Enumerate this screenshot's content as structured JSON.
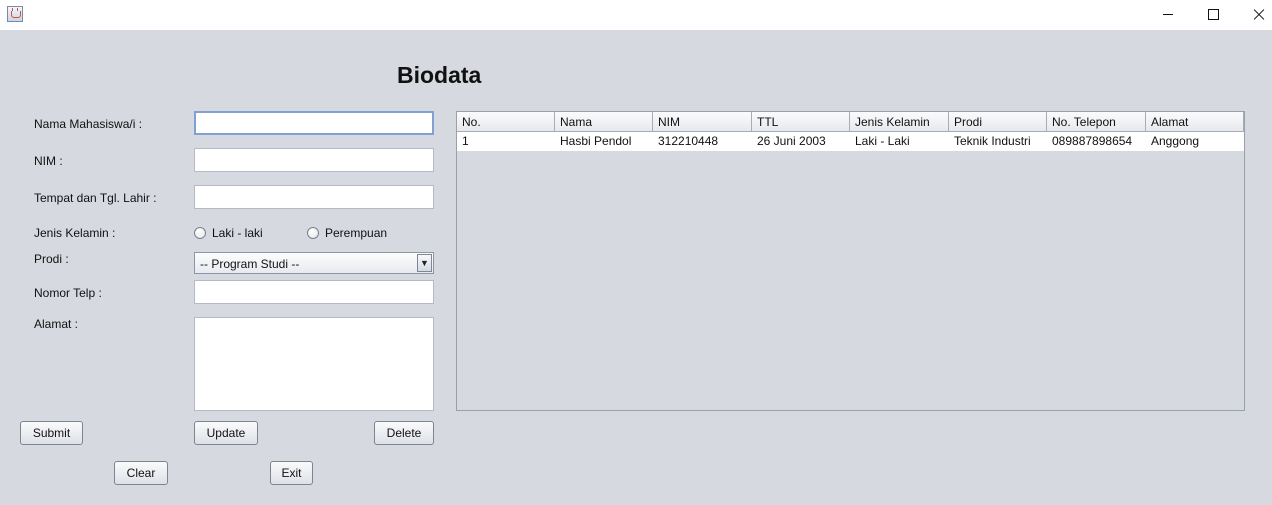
{
  "window": {
    "icon": "java-cup-icon",
    "controls": [
      "minimize-icon",
      "maximize-icon",
      "close-icon"
    ]
  },
  "form": {
    "title": "Biodata",
    "labels": {
      "nama": "Nama Mahasiswa/i :",
      "nim": "NIM :",
      "ttl": "Tempat dan Tgl. Lahir :",
      "jenis_kelamin": "Jenis Kelamin :",
      "prodi": "Prodi :",
      "telp": "Nomor Telp :",
      "alamat": "Alamat :"
    },
    "values": {
      "nama": "",
      "nim": "",
      "ttl": "",
      "telp": "",
      "alamat": ""
    },
    "gender_options": [
      "Laki - laki",
      "Perempuan"
    ],
    "prodi_selected": "-- Program Studi --",
    "buttons": {
      "submit": "Submit",
      "update": "Update",
      "delete": "Delete",
      "clear": "Clear",
      "exit": "Exit"
    }
  },
  "table": {
    "columns": [
      "No.",
      "Nama",
      "NIM",
      "TTL",
      "Jenis Kelamin",
      "Prodi",
      "No. Telepon",
      "Alamat"
    ],
    "rows": [
      [
        "1",
        "Hasbi Pendol",
        "312210448",
        "26 Juni 2003",
        "Laki - Laki",
        "Teknik Industri",
        "089887898654",
        "Anggong"
      ]
    ]
  }
}
